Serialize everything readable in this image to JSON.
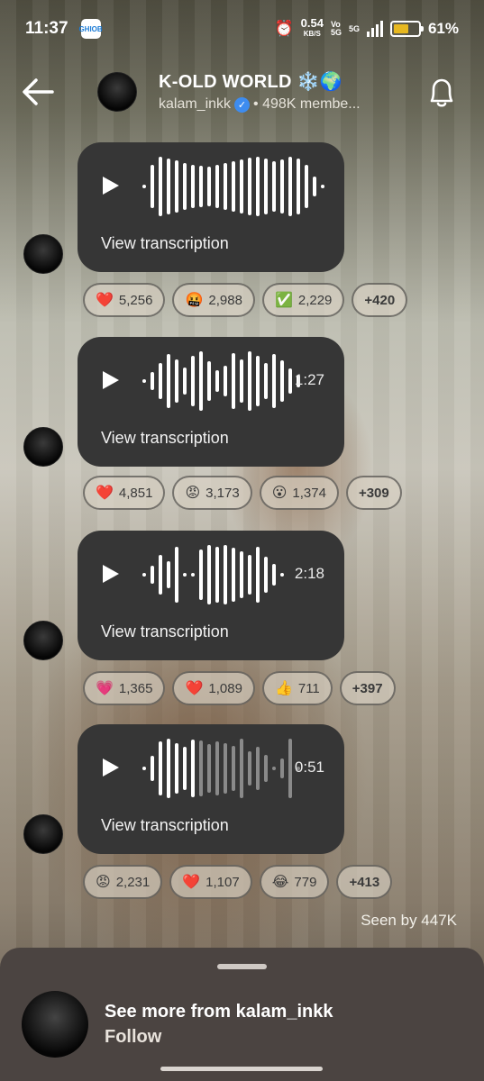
{
  "status_bar": {
    "time": "11:37",
    "app_badge": "GHIOB",
    "speed_value": "0.54",
    "speed_unit": "KB/S",
    "net_top": "Vo",
    "net_bottom": "5G",
    "net_5g": "5G",
    "battery": "61%"
  },
  "header": {
    "channel_name": "K-OLD WORLD ❄️🌍",
    "owner": "kalam_inkk",
    "members": "• 498K membe..."
  },
  "messages": [
    {
      "duration": "",
      "transcription": "View transcription",
      "reactions": [
        {
          "emoji": "❤️",
          "count": "5,256"
        },
        {
          "emoji": "🤬",
          "count": "2,988"
        },
        {
          "emoji": "✅",
          "count": "2,229"
        }
      ],
      "more": "+420"
    },
    {
      "duration": "1:27",
      "transcription": "View transcription",
      "reactions": [
        {
          "emoji": "❤️",
          "count": "4,851"
        },
        {
          "emoji": "😡",
          "count": "3,173"
        },
        {
          "emoji": "😮",
          "count": "1,374"
        }
      ],
      "more": "+309"
    },
    {
      "duration": "2:18",
      "transcription": "View transcription",
      "reactions": [
        {
          "emoji": "💗",
          "count": "1,365"
        },
        {
          "emoji": "❤️",
          "count": "1,089"
        },
        {
          "emoji": "👍",
          "count": "711"
        }
      ],
      "more": "+397"
    },
    {
      "duration": "0:51",
      "transcription": "View transcription",
      "reactions": [
        {
          "emoji": "😡",
          "count": "2,231"
        },
        {
          "emoji": "❤️",
          "count": "1,107"
        },
        {
          "emoji": "😂",
          "count": "779"
        }
      ],
      "more": "+413"
    }
  ],
  "seen_by": "Seen by 447K",
  "sheet": {
    "title": "See more from kalam_inkk",
    "follow": "Follow"
  },
  "colors": {
    "bubble": "#363636",
    "battery_fill": "#e7b820",
    "verified": "#3d8cf0",
    "sheet": "#4b4441"
  }
}
